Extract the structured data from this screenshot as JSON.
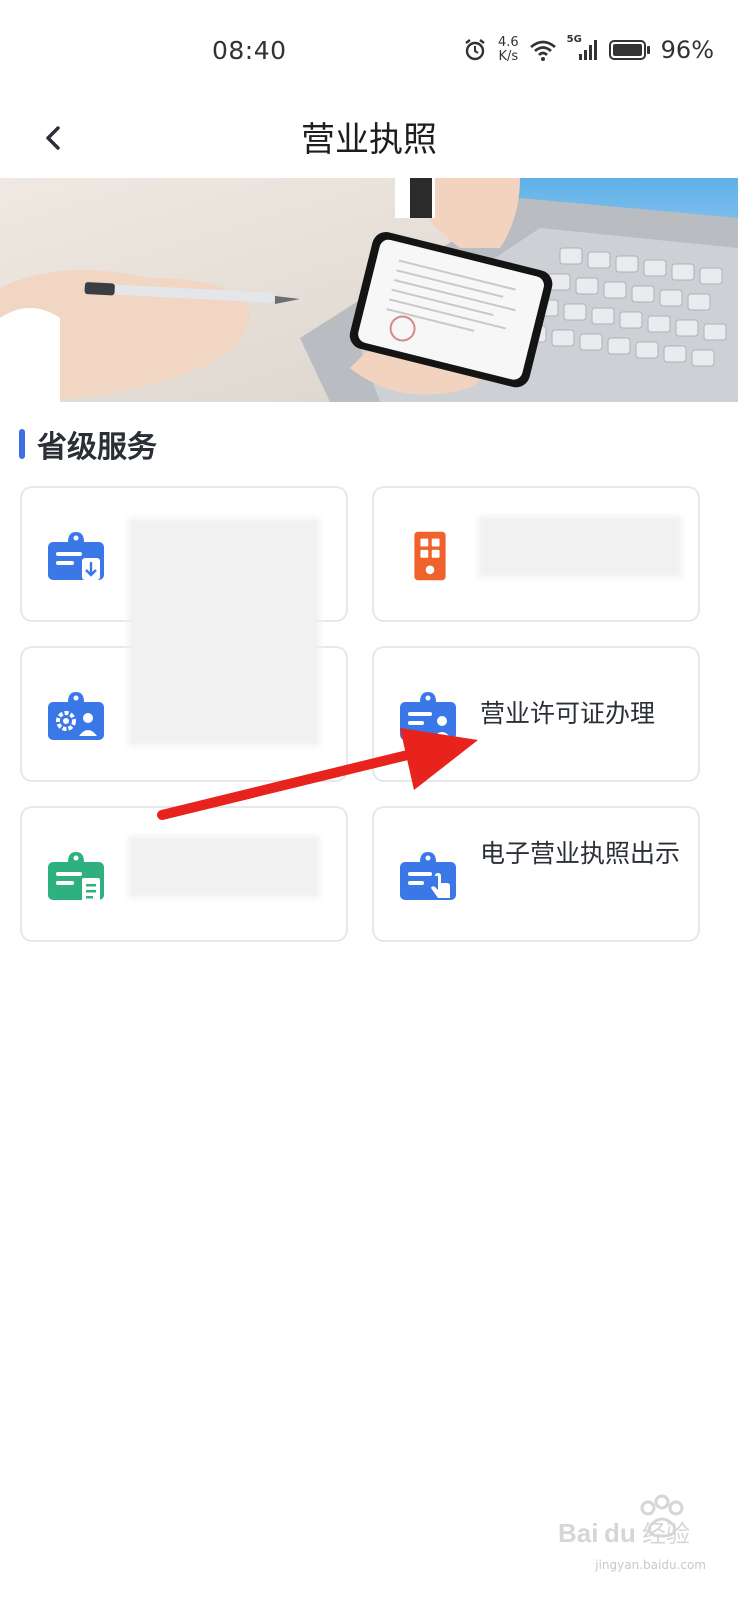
{
  "status_bar": {
    "time": "08:40",
    "net_speed_value": "4.6",
    "net_speed_unit": "K/s",
    "signal_label": "5G",
    "battery_percent": "96%",
    "icons": [
      "alarm-icon",
      "wifi-icon",
      "cellular-signal-icon",
      "battery-icon"
    ]
  },
  "nav": {
    "title": "营业执照",
    "back_icon": "chevron-left-icon"
  },
  "banner": {
    "image": "photo of hands holding a smartphone showing a business license, pen and laptop keyboard"
  },
  "section": {
    "title": "省级服务",
    "accent_color": "#3f6fe0"
  },
  "services": [
    {
      "label": "",
      "icon": "card-download-icon",
      "icon_color": "#3a78e7",
      "blurred": true
    },
    {
      "label": "",
      "icon": "remote-qr-icon",
      "icon_color": "#f0622b",
      "blurred": true
    },
    {
      "label": "",
      "icon": "card-settings-user-icon",
      "icon_color": "#3a78e7",
      "blurred": true
    },
    {
      "label": "营业许可证办理",
      "icon": "card-user-icon",
      "icon_color": "#3a78e7",
      "blurred": false
    },
    {
      "label": "",
      "icon": "card-document-icon",
      "icon_color": "#2fb07f",
      "blurred": true
    },
    {
      "label": "电子营业执照出示",
      "icon": "card-hand-icon",
      "icon_color": "#3a78e7",
      "blurred": false
    }
  ],
  "annotation": {
    "arrow_color": "#e8221c"
  },
  "watermark": {
    "text": "jingyan.baidu.com"
  }
}
